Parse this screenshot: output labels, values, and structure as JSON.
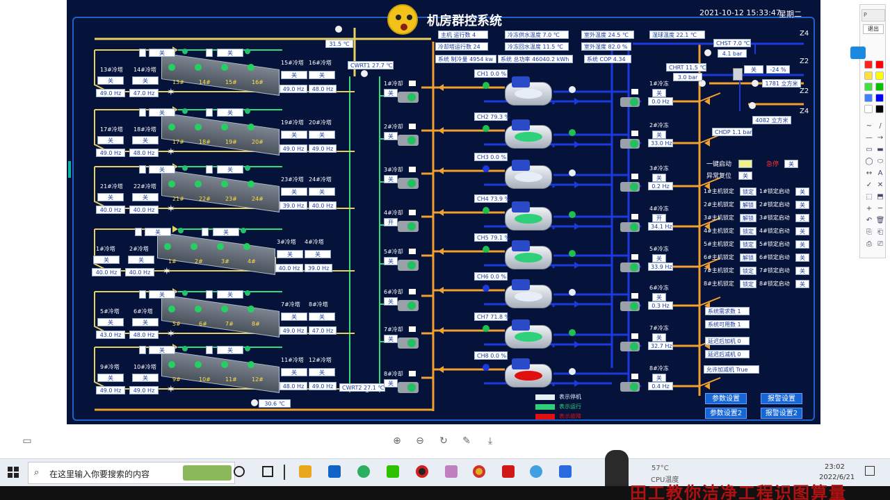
{
  "header": {
    "title": "机房群控系统",
    "datetime": "2021-10-12 15:33:47",
    "weekday": "星期二"
  },
  "top_stats": {
    "main_running": "主机 运行数 4",
    "cooling_tower_running": "冷却塔运行数 24",
    "system_cooling": "系统 制冷量 4954 kw",
    "system_power": "系统 总功率 46040.2 kWh",
    "chw_supply": "冷冻供水温度 7.0 ℃",
    "chw_return": "冷冻回水温度 11.5 ℃",
    "outdoor_temp": "室外温度 24.5 ℃",
    "outdoor_hum": "室外湿度 82.0 %",
    "system_cop": "系统 COP 4.34",
    "wet_bulb": "湿球温度 22.1 ℃"
  },
  "sensors": {
    "top_temp": "31.5 ℃",
    "bottom_temp": "30.6 ℃",
    "cwrt1": "CWRT1 27.7 ℃",
    "cwrt2": "CWRT2 27.1 ℃",
    "chst_temp": "CHST 7.0 ℃",
    "chst_bar": "4.1 bar",
    "chrt_temp": "CHRT 11.5 ℃",
    "chrt_bar": "3.0 bar",
    "chdp": "CHDP 1.1 bar",
    "bypass_state": "关",
    "bypass_pct": "-24 %",
    "flow1": "1781 立方米",
    "flow2": "4082 立方米",
    "zones": [
      "Z4",
      "Z2",
      "Z2",
      "Z4"
    ]
  },
  "tower_groups": [
    {
      "names": [
        "13#冷塔",
        "14#冷塔",
        "15#冷塔",
        "16#冷塔"
      ],
      "states": [
        "关",
        "关",
        "关",
        "关"
      ],
      "hz": [
        "49.0 Hz",
        "47.0 Hz",
        "49.0 Hz",
        "48.0 Hz"
      ],
      "ids": [
        "13#",
        "14#",
        "15#",
        "16#"
      ],
      "fan_state": "关"
    },
    {
      "names": [
        "17#冷塔",
        "18#冷塔",
        "19#冷塔",
        "20#冷塔"
      ],
      "states": [
        "关",
        "关",
        "关",
        "关"
      ],
      "hz": [
        "49.0 Hz",
        "48.0 Hz",
        "49.0 Hz",
        "49.0 Hz"
      ],
      "ids": [
        "17#",
        "18#",
        "19#",
        "20#"
      ],
      "fan_state": "关"
    },
    {
      "names": [
        "21#冷塔",
        "22#冷塔",
        "23#冷塔",
        "24#冷塔"
      ],
      "states": [
        "关",
        "关",
        "关",
        "关"
      ],
      "hz": [
        "40.0 Hz",
        "40.0 Hz",
        "39.0 Hz",
        "40.0 Hz"
      ],
      "ids": [
        "21#",
        "22#",
        "23#",
        "24#"
      ],
      "fan_state": "关"
    },
    {
      "names": [
        "1#冷塔",
        "2#冷塔",
        "3#冷塔",
        "4#冷塔"
      ],
      "states": [
        "关",
        "关",
        "关",
        "关"
      ],
      "hz": [
        "40.0 Hz",
        "40.0 Hz",
        "40.0 Hz",
        "39.0 Hz"
      ],
      "ids": [
        "1#",
        "2#",
        "3#",
        "4#"
      ],
      "fan_state": "关"
    },
    {
      "names": [
        "5#冷塔",
        "6#冷塔",
        "7#冷塔",
        "8#冷塔"
      ],
      "states": [
        "关",
        "关",
        "关",
        "关"
      ],
      "hz": [
        "43.0 Hz",
        "48.0 Hz",
        "49.0 Hz",
        "47.0 Hz"
      ],
      "ids": [
        "5#",
        "6#",
        "7#",
        "8#"
      ],
      "fan_state": "关"
    },
    {
      "names": [
        "9#冷塔",
        "10#冷塔",
        "11#冷塔",
        "12#冷塔"
      ],
      "states": [
        "关",
        "关",
        "关",
        "关"
      ],
      "hz": [
        "49.0 Hz",
        "49.0 Hz",
        "48.0 Hz",
        "49.0 Hz"
      ],
      "ids": [
        "9#",
        "10#",
        "11#",
        "12#"
      ],
      "fan_state": "关"
    }
  ],
  "cw_pumps": [
    {
      "name": "1#冷却",
      "state": "关"
    },
    {
      "name": "2#冷却",
      "state": "关"
    },
    {
      "name": "3#冷却",
      "state": "关"
    },
    {
      "name": "4#冷却",
      "state": "开"
    },
    {
      "name": "5#冷却",
      "state": "关"
    },
    {
      "name": "6#冷却",
      "state": "关"
    },
    {
      "name": "7#冷却",
      "state": "关"
    },
    {
      "name": "8#冷却",
      "state": "关"
    }
  ],
  "chillers": [
    {
      "label": "CH1 0.0 %",
      "status": "stopped"
    },
    {
      "label": "CH2 79.3 %",
      "status": "running"
    },
    {
      "label": "CH3 0.0 %",
      "status": "stopped"
    },
    {
      "label": "CH4 73.9 %",
      "status": "running"
    },
    {
      "label": "CH5 79.1 %",
      "status": "running"
    },
    {
      "label": "CH6 0.0 %",
      "status": "stopped"
    },
    {
      "label": "CH7 71.8 %",
      "status": "running"
    },
    {
      "label": "CH8 0.0 %",
      "status": "fault"
    }
  ],
  "chw_pumps": [
    {
      "name": "1#冷冻",
      "state": "关",
      "hz": "0.0 Hz"
    },
    {
      "name": "2#冷冻",
      "state": "关",
      "hz": "33.0 Hz"
    },
    {
      "name": "3#冷冻",
      "state": "关",
      "hz": "0.2 Hz"
    },
    {
      "name": "4#冷冻",
      "state": "开",
      "hz": "34.1 Hz"
    },
    {
      "name": "5#冷冻",
      "state": "关",
      "hz": "33.9 Hz"
    },
    {
      "name": "6#冷冻",
      "state": "关",
      "hz": "0.3 Hz"
    },
    {
      "name": "7#冷冻",
      "state": "关",
      "hz": "32.7 Hz"
    },
    {
      "name": "8#冷冻",
      "state": "关",
      "hz": "0.4 Hz"
    }
  ],
  "controls": {
    "one_key_start": "一键启动",
    "one_key_value": "",
    "emergency_stop": "急停",
    "emergency_value": "关",
    "fault_reset": "异常复位",
    "fault_reset_value": "关",
    "locks": [
      {
        "label": "1#主机锁定",
        "lock": "锁定",
        "auto": "1#锁定启动",
        "value": "关"
      },
      {
        "label": "2#主机锁定",
        "lock": "解锁",
        "auto": "2#锁定启动",
        "value": "关"
      },
      {
        "label": "3#主机锁定",
        "lock": "解锁",
        "auto": "3#锁定启动",
        "value": "关"
      },
      {
        "label": "4#主机锁定",
        "lock": "锁定",
        "auto": "4#锁定启动",
        "value": "关"
      },
      {
        "label": "5#主机锁定",
        "lock": "锁定",
        "auto": "5#锁定启动",
        "value": "关"
      },
      {
        "label": "6#主机锁定",
        "lock": "解锁",
        "auto": "6#锁定启动",
        "value": "关"
      },
      {
        "label": "7#主机锁定",
        "lock": "锁定",
        "auto": "7#锁定启动",
        "value": "关"
      },
      {
        "label": "8#主机锁定",
        "lock": "锁定",
        "auto": "8#锁定启动",
        "value": "关"
      }
    ],
    "system_demand": "系统需求数 1",
    "system_available": "系统可用数 1",
    "delay_add": "延迟后加机 0",
    "delay_remove": "延迟后减机 0",
    "allow_add_remove": "允许加减机 True"
  },
  "legend": [
    {
      "label": "表示停机",
      "color": "#e8eef8"
    },
    {
      "label": "表示运行",
      "color": "#2fd07a"
    },
    {
      "label": "表示故障",
      "color": "#e01010"
    }
  ],
  "buttons": {
    "param_settings": "参数设置",
    "alarm_settings": "报警设置",
    "param_settings2": "参数设置2",
    "alarm_settings2": "报警设置2"
  },
  "viewer_tools": [
    "zoom-in-icon",
    "zoom-out-icon",
    "rotate-icon",
    "edit-icon",
    "download-icon"
  ],
  "right_toolbar": {
    "exit_label": "退出",
    "colors": [
      "#ff2020",
      "#ff0000",
      "#ffe040",
      "#ffff00",
      "#40e040",
      "#00c000",
      "#4080ff",
      "#0000ff",
      "#ffffff",
      "#000000"
    ]
  },
  "taskbar": {
    "search_placeholder": "在这里输入你要搜索的内容",
    "temp": "57°C",
    "temp_label": "CPU温度",
    "time": "23:02",
    "date": "2022/6/21"
  },
  "watermark": "田工教你洁净工程识图算量",
  "colors": {
    "panel_bg": "#05123a",
    "cooling_water": "#f2a030",
    "supply_water": "#e8d060",
    "chilled_water": "#1a3ae0",
    "return_water": "#2fe07a",
    "accent": "#1766d6"
  }
}
